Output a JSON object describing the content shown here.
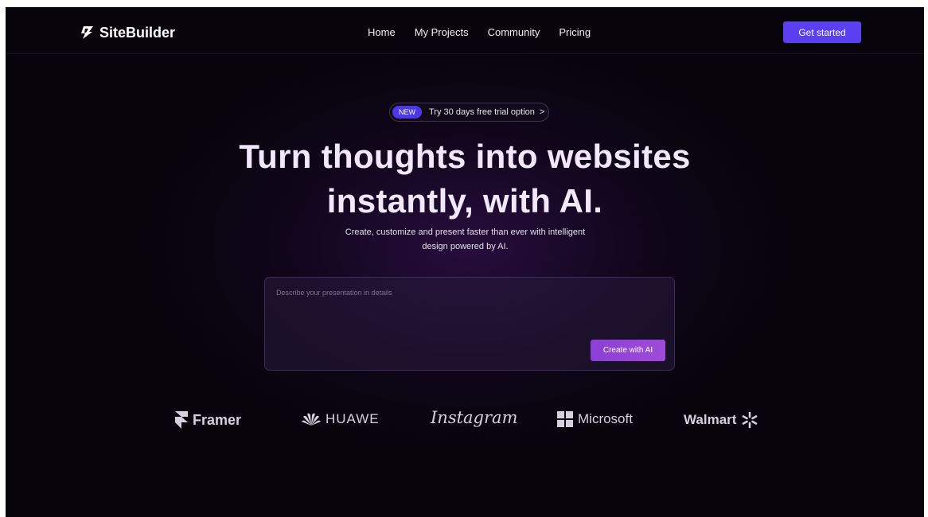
{
  "brand": {
    "name": "SiteBuilder",
    "icon": "lightning-logo-icon"
  },
  "nav": {
    "links": [
      "Home",
      "My Projects",
      "Community",
      "Pricing"
    ],
    "cta_label": "Get started"
  },
  "announcement": {
    "badge": "NEW",
    "text": "Try 30 days free trial option",
    "arrow": ">"
  },
  "hero": {
    "headline_line1": "Turn thoughts into websites",
    "headline_line2": "instantly, with AI.",
    "subtext_line1": "Create, customize and present faster than ever with intelligent",
    "subtext_line2": "design powered by AI."
  },
  "prompt": {
    "placeholder": "Describe your presentation in details",
    "value": "",
    "button_label": "Create with AI"
  },
  "logos": [
    {
      "name": "Framer",
      "icon": "framer-icon"
    },
    {
      "name": "HUAWE",
      "icon": "huawei-icon"
    },
    {
      "name": "Instagram",
      "icon": ""
    },
    {
      "name": "Microsoft",
      "icon": "microsoft-icon"
    },
    {
      "name": "Walmart",
      "icon": "walmart-spark-icon"
    }
  ],
  "colors": {
    "background": "#07040b",
    "accent": "#5b40f2",
    "create_button": "#9444d8",
    "headline": "#f1e9fb"
  }
}
